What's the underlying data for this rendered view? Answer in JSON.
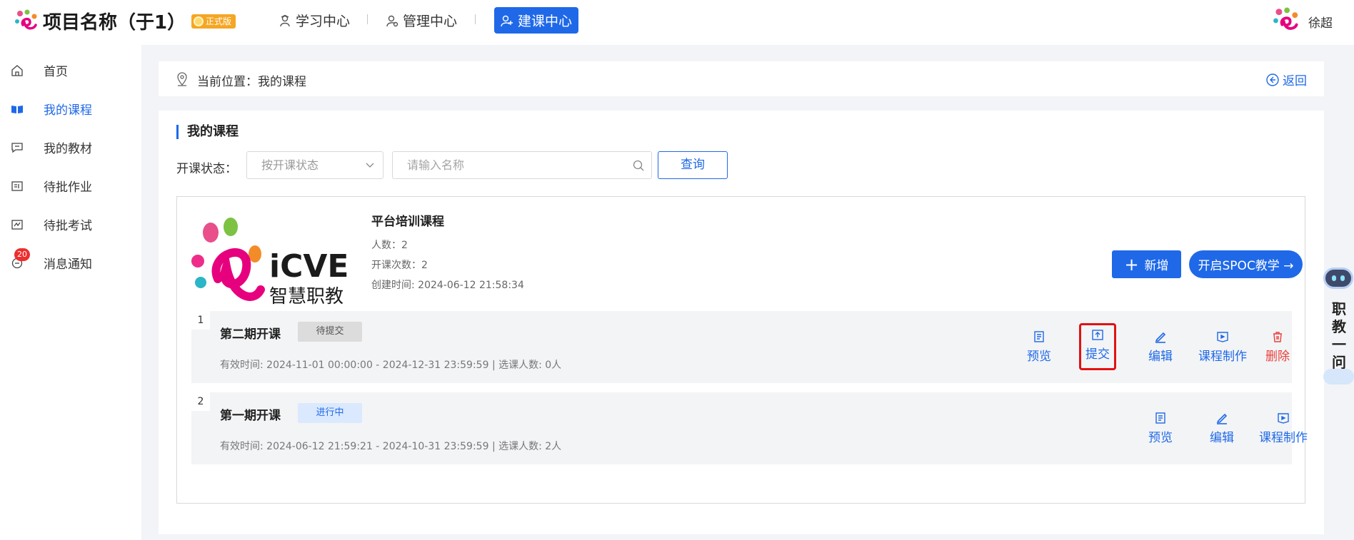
{
  "header": {
    "project_title": "项目名称（于1）",
    "edition_badge": "正式版",
    "nav": [
      {
        "label": "学习中心",
        "icon": "student-icon",
        "active": false
      },
      {
        "label": "管理中心",
        "icon": "manager-icon",
        "active": false
      },
      {
        "label": "建课中心",
        "icon": "course-builder-icon",
        "active": true
      }
    ],
    "user_name": "徐超"
  },
  "sidebar": {
    "items": [
      {
        "label": "首页",
        "icon": "home-icon",
        "active": false
      },
      {
        "label": "我的课程",
        "icon": "book-icon",
        "active": true
      },
      {
        "label": "我的教材",
        "icon": "message-icon",
        "active": false
      },
      {
        "label": "待批作业",
        "icon": "homework-icon",
        "active": false
      },
      {
        "label": "待批考试",
        "icon": "exam-icon",
        "active": false
      },
      {
        "label": "消息通知",
        "icon": "notification-icon",
        "active": false,
        "badge": "20"
      }
    ]
  },
  "breadcrumb": {
    "text": "当前位置：我的课程",
    "back_label": "返回"
  },
  "main": {
    "section_title": "我的课程",
    "filter_label": "开课状态：",
    "status_select_placeholder": "按开课状态",
    "search_placeholder": "请输入名称",
    "query_button": "查询",
    "course": {
      "name": "平台培训课程",
      "logo_text": "iCVE",
      "logo_subtext": "智慧职教",
      "students": "人数：2",
      "sessions_count": "开课次数：2",
      "created": "创建时间: 2024-06-12 21:58:34",
      "add_button": "新增",
      "spoc_button": "开启SPOC教学 →",
      "sessions": [
        {
          "index": "1",
          "name": "第二期开课",
          "status": "待提交",
          "info": "有效时间: 2024-11-01 00:00:00 - 2024-12-31 23:59:59    |    选课人数: 0人",
          "actions": [
            "预览",
            "提交",
            "编辑",
            "课程制作",
            "删除"
          ]
        },
        {
          "index": "2",
          "name": "第一期开课",
          "status": "进行中",
          "info": "有效时间: 2024-06-12 21:59:21 - 2024-10-31 23:59:59    |    选课人数: 2人",
          "actions": [
            "预览",
            "编辑",
            "课程制作"
          ]
        }
      ]
    }
  },
  "assistant": {
    "label": "职教一问"
  },
  "colors": {
    "primary": "#1f69e8",
    "danger": "#e8413c",
    "highlight_box": "#e21212",
    "badge": "#f5a623",
    "notification_badge": "#ee2d2d"
  }
}
